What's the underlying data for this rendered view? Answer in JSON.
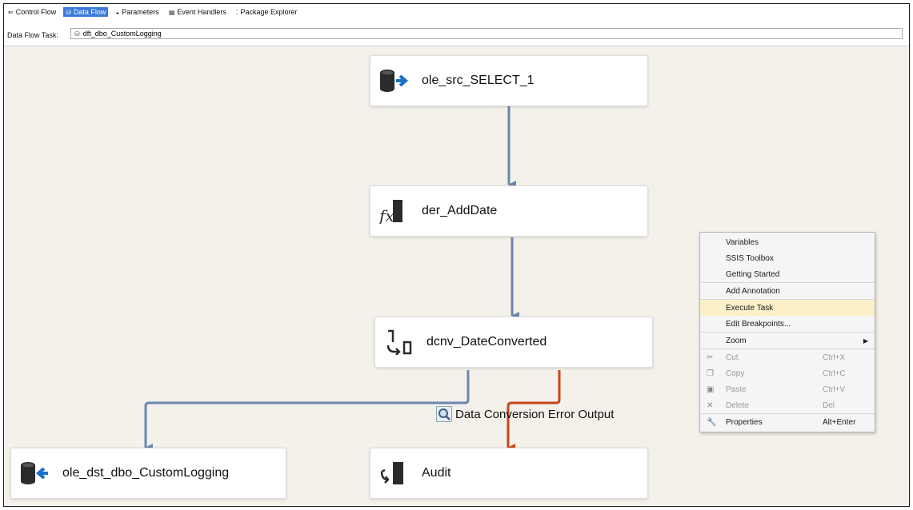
{
  "tabs": [
    {
      "label": "Control Flow",
      "icon": "control-flow-icon",
      "glyph": "⇐"
    },
    {
      "label": "Data Flow",
      "icon": "data-flow-icon",
      "glyph": "⛁",
      "active": true
    },
    {
      "label": "Parameters",
      "icon": "parameters-icon",
      "glyph": "◒"
    },
    {
      "label": "Event Handlers",
      "icon": "event-handlers-icon",
      "glyph": "▤"
    },
    {
      "label": "Package Explorer",
      "icon": "package-explorer-icon",
      "glyph": "⁚"
    }
  ],
  "task": {
    "label": "Data Flow Task:",
    "value": "dft_dbo_CustomLogging"
  },
  "nodes": {
    "source": "ole_src_SELECT_1",
    "derived": "der_AddDate",
    "convert": "dcnv_DateConverted",
    "destination": "ole_dst_dbo_CustomLogging",
    "audit": "Audit"
  },
  "error_output_label": "Data Conversion Error Output",
  "colors": {
    "path": "#6a86b0",
    "error_path": "#c8461a",
    "menu_highlight": "#fbf0c8",
    "tab_active": "#3c7ad8"
  },
  "context_menu": {
    "items": [
      {
        "label": "Variables"
      },
      {
        "label": "SSIS Toolbox"
      },
      {
        "label": "Getting Started"
      },
      {
        "label": "Add Annotation"
      },
      {
        "label": "Execute Task",
        "highlighted": true
      },
      {
        "label": "Edit Breakpoints..."
      },
      {
        "label": "Zoom",
        "submenu": true
      },
      {
        "label": "Cut",
        "shortcut": "Ctrl+X",
        "disabled": true,
        "icon": "cut-icon"
      },
      {
        "label": "Copy",
        "shortcut": "Ctrl+C",
        "disabled": true,
        "icon": "copy-icon"
      },
      {
        "label": "Paste",
        "shortcut": "Ctrl+V",
        "disabled": true,
        "icon": "paste-icon"
      },
      {
        "label": "Delete",
        "shortcut": "Del",
        "disabled": true,
        "icon": "delete-icon"
      },
      {
        "label": "Properties",
        "shortcut": "Alt+Enter",
        "icon": "wrench-icon"
      }
    ]
  }
}
